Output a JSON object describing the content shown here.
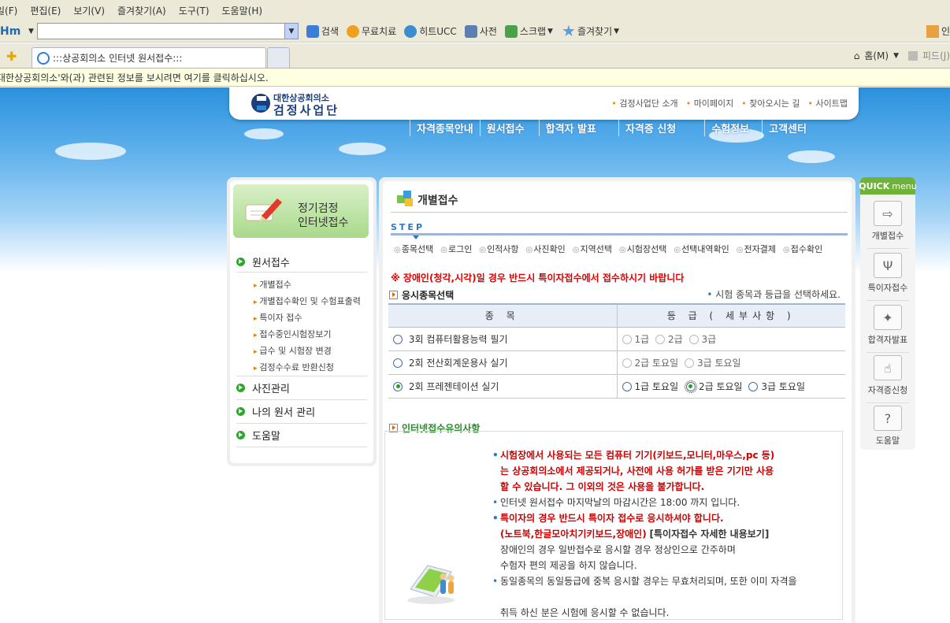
{
  "browser": {
    "menu": [
      "일(F)",
      "편집(E)",
      "보기(V)",
      "즐겨찾기(A)",
      "도구(T)",
      "도움말(H)"
    ],
    "toolbar_logo": "Hm",
    "toolbar_buttons": [
      "검색",
      "무료치료",
      "히트UCC",
      "사전",
      "스크랩",
      "즐겨찾기"
    ],
    "toolbar_right": "인",
    "tab_title": ":::상공회의소 인터넷 원서접수:::",
    "home_label": "홈(M)",
    "feed_label": "피드(J)",
    "infobar_text": "대한상공회의소'와(과) 관련된 정보를 보시려면 여기를 클릭하십시오."
  },
  "site": {
    "logo_top": "대한상공회의소",
    "logo_bottom": "검정사업단",
    "util_nav": [
      "검정사업단 소개",
      "마이페이지",
      "찾아오시는 길",
      "사이트맵"
    ],
    "gnb": [
      "자격종목안내",
      "원서접수",
      "합격자 발표",
      "자격증 신청",
      "수험정보",
      "고객센터"
    ]
  },
  "left_menu": {
    "banner_line1": "정기검정",
    "banner_line2": "인터넷접수",
    "main_items": [
      "원서접수",
      "사진관리",
      "나의 원서 관리",
      "도움말"
    ],
    "sub_items": [
      "개별접수",
      "개별접수확인 및 수험표출력",
      "특이자 접수",
      "접수중인시험장보기",
      "급수 및 시험장 변경",
      "검정수수료 반환신청"
    ]
  },
  "main": {
    "title": "개별접수",
    "step_label": "STEP",
    "steps": [
      "종목선택",
      "로그인",
      "인적사항",
      "사진확인",
      "지역선택",
      "시험장선택",
      "선택내역확인",
      "전자결제",
      "접수확인"
    ],
    "warning": "※ 장애인(청각,시각)일 경우 반드시 특이자접수에서 접수하시기 바랍니다",
    "section1": "응시종목선택",
    "section1_hint": "시험 종목과 등급을 선택하세요.",
    "table": {
      "headers": [
        "종 목",
        "등 급 ( 세부사항 )"
      ],
      "rows": [
        {
          "subject": "3회 컴퓨터활용능력 필기",
          "grades": [
            "1급",
            "2급",
            "3급"
          ]
        },
        {
          "subject": "2회 전산회계운용사 실기",
          "grades": [
            "2급 토요일",
            "3급 토요일"
          ]
        },
        {
          "subject": "2회 프레젠테이션 실기",
          "grades": [
            "1급 토요일",
            "2급 토요일",
            "3급 토요일"
          ]
        }
      ]
    },
    "section2": "인터넷접수유의사항",
    "notice": {
      "n1": "시험장에서 사용되는 모든 컴퓨터 기기(키보드,모니터,마우스,pc 등)",
      "n1b": "는 상공회의소에서 제공되거나, 사전에 사용 허가를 받은 기기만 사용",
      "n1c": "할 수 있습니다. 그 이외의 것은 사용을 불가합니다.",
      "n2": "인터넷 원서접수 마지막날의 마감시간은 18:00 까지 입니다.",
      "n3": "특이자의 경우 반드시 특이자 접수로 응시하셔야 합니다.",
      "n3b": "(노트북,한글모아치기키보드,장애인)",
      "n3link": "[특이자접수 자세한 내용보기]",
      "n3c": "장애인의 경우 일반접수로 응시할 경우 정상인으로 간주하며",
      "n3d": "수험자 편의 제공을 하지 않습니다.",
      "n4": "동일종목의 동일등급에 중복 응시할 경우는 무효처리되며, 또한 이미 자격을",
      "n4b": "취득 하신 분은 시험에 응시할 수 없습니다."
    }
  },
  "quick": {
    "head1": "QUICK",
    "head2": "menu",
    "items": [
      "개별접수",
      "특이자접수",
      "합격자발표",
      "자격증신청",
      "도움말"
    ]
  },
  "colors": {
    "accent_blue": "#2e78c4",
    "warning_red": "#e00000",
    "quick_green": "#6fb23a"
  }
}
